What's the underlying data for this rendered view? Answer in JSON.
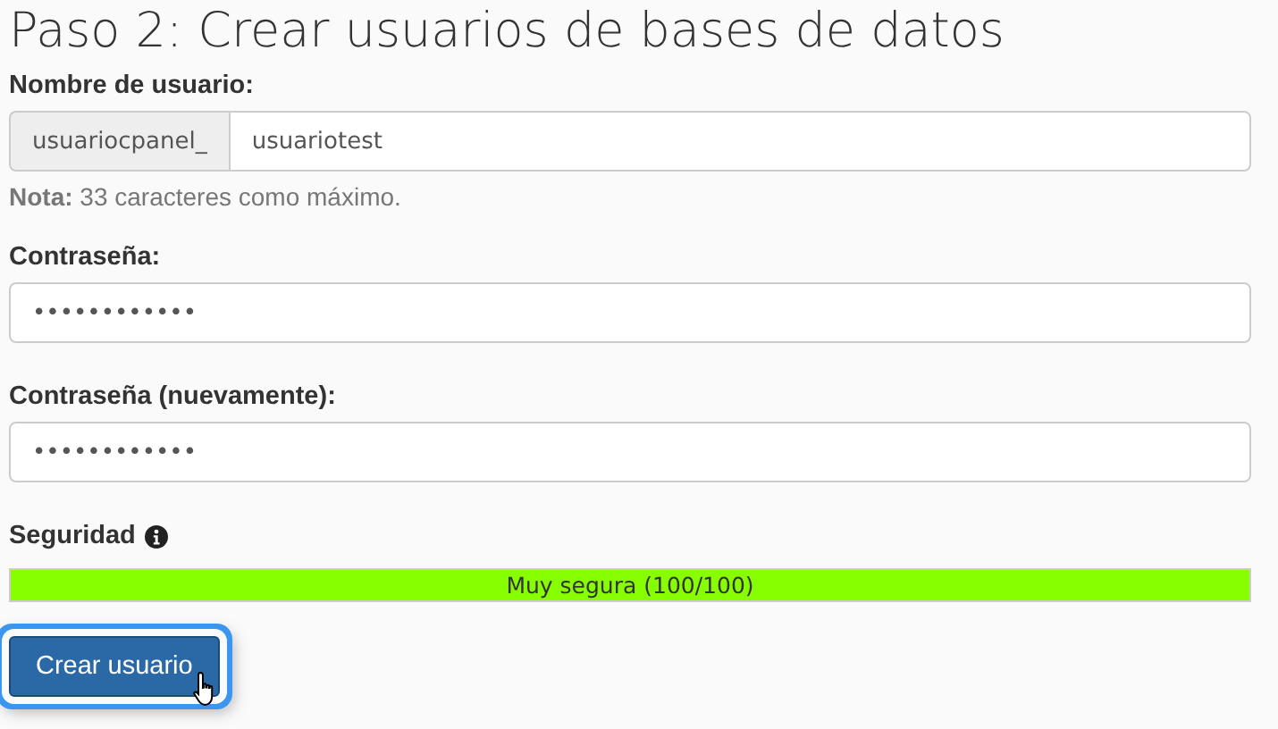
{
  "title": "Paso 2: Crear usuarios de bases de datos",
  "username": {
    "label": "Nombre de usuario:",
    "prefix": "usuariocpanel_",
    "value": "usuariotest"
  },
  "note": "**Nota:** 33 caracteres como máximo.",
  "password_fields": [
    {
      "label": "Contraseña:",
      "value": "••••••••••••"
    },
    {
      "label": "Contraseña (nuevamente):",
      "value": "••••••••••••"
    }
  ],
  "strength": {
    "label": "Seguridad",
    "level": 1.0,
    "reading": "Muy segura (100/100)"
  },
  "submit": {
    "label": "Crear usuario",
    "focused": true
  }
}
